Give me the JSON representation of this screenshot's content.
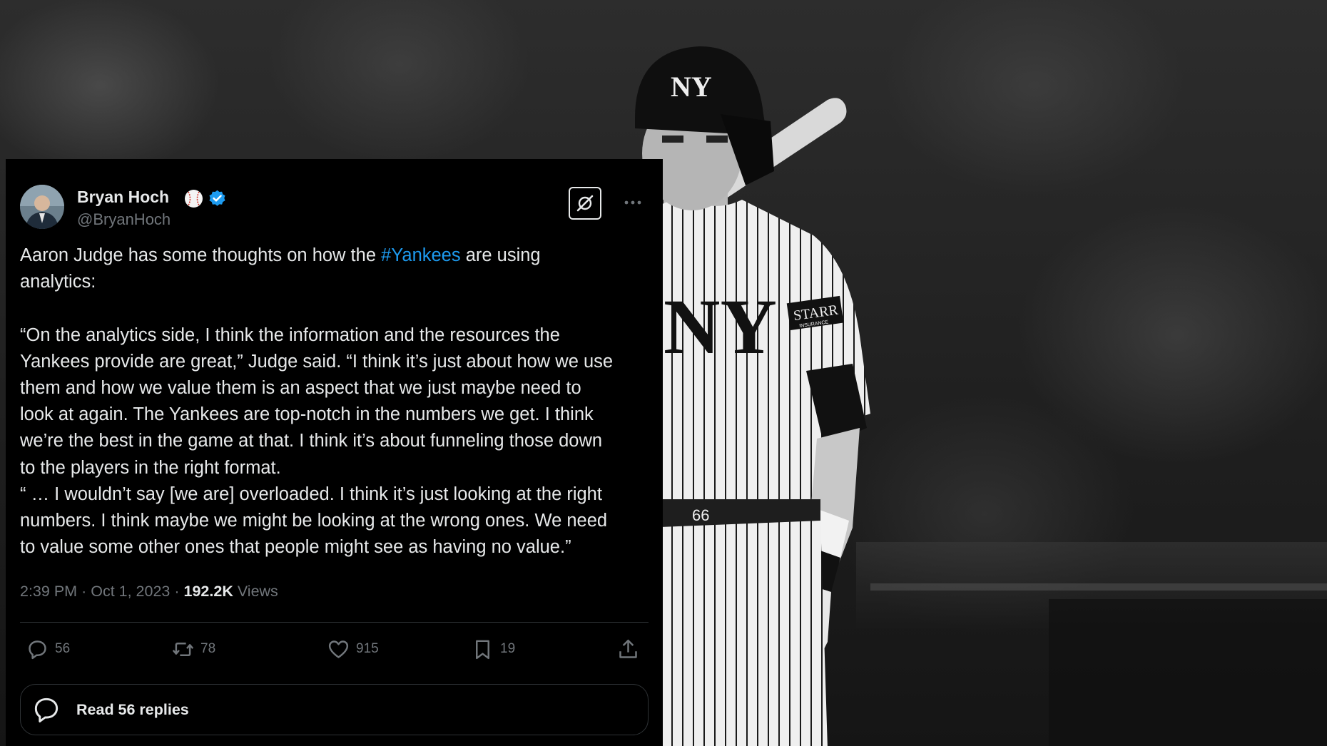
{
  "author": {
    "name": "Bryan Hoch",
    "handle": "@BryanHoch",
    "badge_icon": "baseball-icon",
    "verified_icon": "verified-badge-icon"
  },
  "tweet": {
    "line1_prefix": "Aaron Judge has some thoughts on how the ",
    "hashtag": "#Yankees",
    "line1_suffix": " are using\nanalytics:",
    "body": "“On the analytics side, I think the information and the resources the\nYankees provide are great,” Judge said. “I think it’s just about how we use\nthem and how we value them is an aspect that we just maybe need to\nlook at again. The Yankees are top-notch in the numbers we get. I think\nwe’re the best in the game at that. I think it’s about funneling those down\nto the players in the right format.\n“ … I wouldn’t say [we are] overloaded. I think it’s just looking at the right\nnumbers. I think maybe we might be looking at the wrong ones. We need\nto value some other ones that people might see as having no value.”"
  },
  "meta": {
    "time": "2:39 PM",
    "separator": "·",
    "date": "Oct 1, 2023",
    "views_count": "192.2K",
    "views_label": "Views"
  },
  "actions": {
    "replies": "56",
    "reposts": "78",
    "likes": "915",
    "bookmarks": "19"
  },
  "read_replies_label": "Read 56 replies",
  "colors": {
    "card_bg": "#000000",
    "text": "#e7e9ea",
    "muted": "#71767b",
    "accent": "#1d9bf0",
    "divider": "#2f3336"
  },
  "background": {
    "jersey_number": "66",
    "sleeve_patch": "STARR",
    "sleeve_patch_sub": "INSURANCE"
  }
}
